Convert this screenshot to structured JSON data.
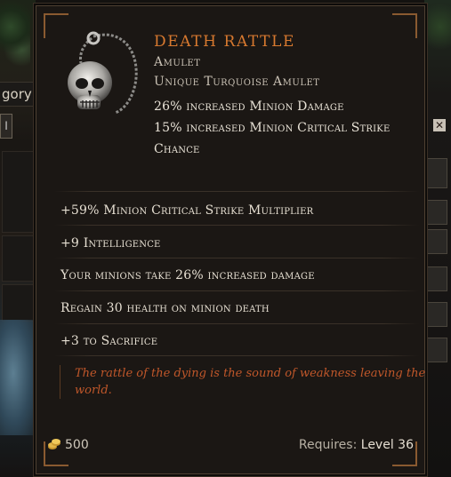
{
  "background": {
    "category_label": "gory",
    "field_value": "l",
    "close_glyph": "✕"
  },
  "item": {
    "name": "Death Rattle",
    "base_type": "Amulet",
    "rarity_type": "Unique Turquoise Amulet",
    "icon": "skull-amulet-icon",
    "implicits": [
      "26% increased Minion Damage",
      "15% increased Minion Critical Strike Chance"
    ],
    "affixes": [
      "+59% Minion Critical Strike Multiplier",
      "+9 Intelligence",
      "Your minions take 26% increased damage",
      "Regain 30 health on minion death",
      "+3 to Sacrifice"
    ],
    "lore": "The rattle of the dying is the sound of weakness leaving the world.",
    "price": "500",
    "requires_label": "Requires:",
    "requires_level": "Level 36"
  },
  "colors": {
    "title": "#d8792f",
    "lore": "#c0572a",
    "panel": "#1b1714"
  }
}
